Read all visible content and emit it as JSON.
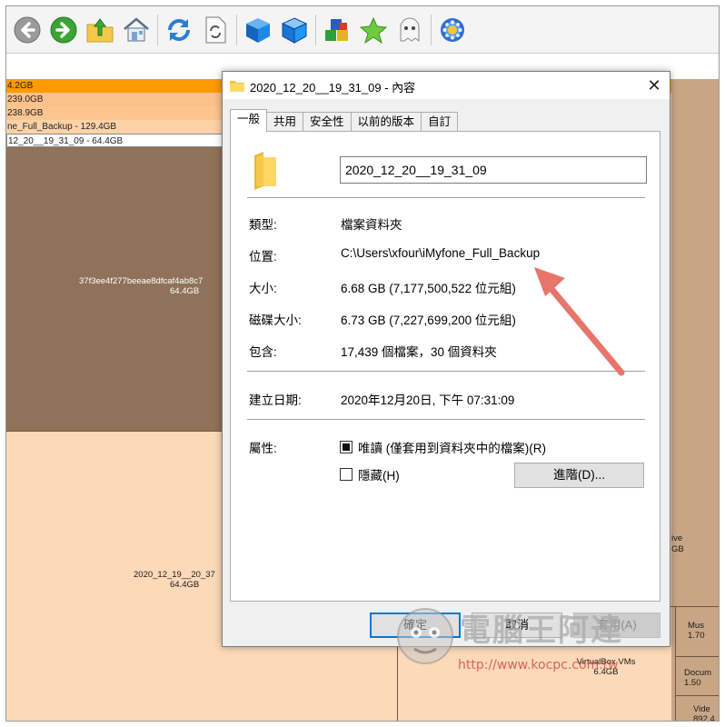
{
  "toolbar": {
    "buttons": [
      {
        "icon": "back-arrow-icon"
      },
      {
        "icon": "forward-arrow-icon"
      },
      {
        "icon": "folder-up-icon"
      },
      {
        "icon": "home-icon"
      },
      {
        "icon": "refresh-icon"
      },
      {
        "icon": "document-refresh-icon"
      },
      {
        "icon": "blue-cube-icon"
      },
      {
        "icon": "blue-cube-outline-icon"
      },
      {
        "icon": "colored-blocks-icon"
      },
      {
        "icon": "star-icon"
      },
      {
        "icon": "ghost-icon"
      },
      {
        "icon": "gear-flower-icon"
      }
    ]
  },
  "treemap": {
    "bars": [
      {
        "label": "4.2GB",
        "color": "#fc9a00"
      },
      {
        "label": "239.0GB",
        "color": "#fcc089"
      },
      {
        "label": "238.9GB",
        "color": "#fcc58f"
      },
      {
        "label": "ne_Full_Backup - 129.4GB",
        "color": "#fcd2a6"
      },
      {
        "label": "12_20__19_31_09 - 64.4GB",
        "color": "#ffffff"
      }
    ],
    "cells": {
      "selected": {
        "name": "37f3ee4f277beeae8dfcaf4ab8c7",
        "size": "64.4GB",
        "color": "#8f7259"
      },
      "lower": {
        "name": "2020_12_19__20_37",
        "size": "64.4GB",
        "color": "#fcd9b8"
      },
      "right_column_color": "#c8a685",
      "drive": {
        "name": "ive",
        "size": "GB"
      },
      "vbox": {
        "name": "VirtualBox VMs",
        "size": "6.4GB"
      },
      "music": {
        "name": "Mus",
        "size": "1.70"
      },
      "documents": {
        "name": "Docum",
        "size": "1.50"
      },
      "videos": {
        "name": "Vide",
        "size": "892.4"
      }
    }
  },
  "dialog": {
    "title": "2020_12_20__19_31_09 - 內容",
    "tabs": [
      "一般",
      "共用",
      "安全性",
      "以前的版本",
      "自訂"
    ],
    "folder_name": "2020_12_20__19_31_09",
    "type_label": "類型:",
    "type_value": "檔案資料夾",
    "location_label": "位置:",
    "location_value": "C:\\Users\\xfour\\iMyfone_Full_Backup",
    "size_label": "大小:",
    "size_value": "6.68 GB (7,177,500,522 位元組)",
    "disk_size_label": "磁碟大小:",
    "disk_size_value": "6.73 GB (7,227,699,200 位元組)",
    "contains_label": "包含:",
    "contains_value": "17,439 個檔案，30 個資料夾",
    "created_label": "建立日期:",
    "created_value": "2020年12月20日, 下午 07:31:09",
    "attributes_label": "屬性:",
    "readonly_label": "唯讀 (僅套用到資料夾中的檔案)(R)",
    "readonly_checked": true,
    "hidden_label": "隱藏(H)",
    "hidden_checked": false,
    "advanced_button": "進階(D)...",
    "ok_button": "確定",
    "cancel_button": "取消",
    "apply_button": "套用(A)"
  },
  "annotation": {
    "arrow_color": "#e8756a"
  },
  "watermark": {
    "title": "電腦王阿達",
    "url": "http://www.kocpc.com.tw"
  }
}
